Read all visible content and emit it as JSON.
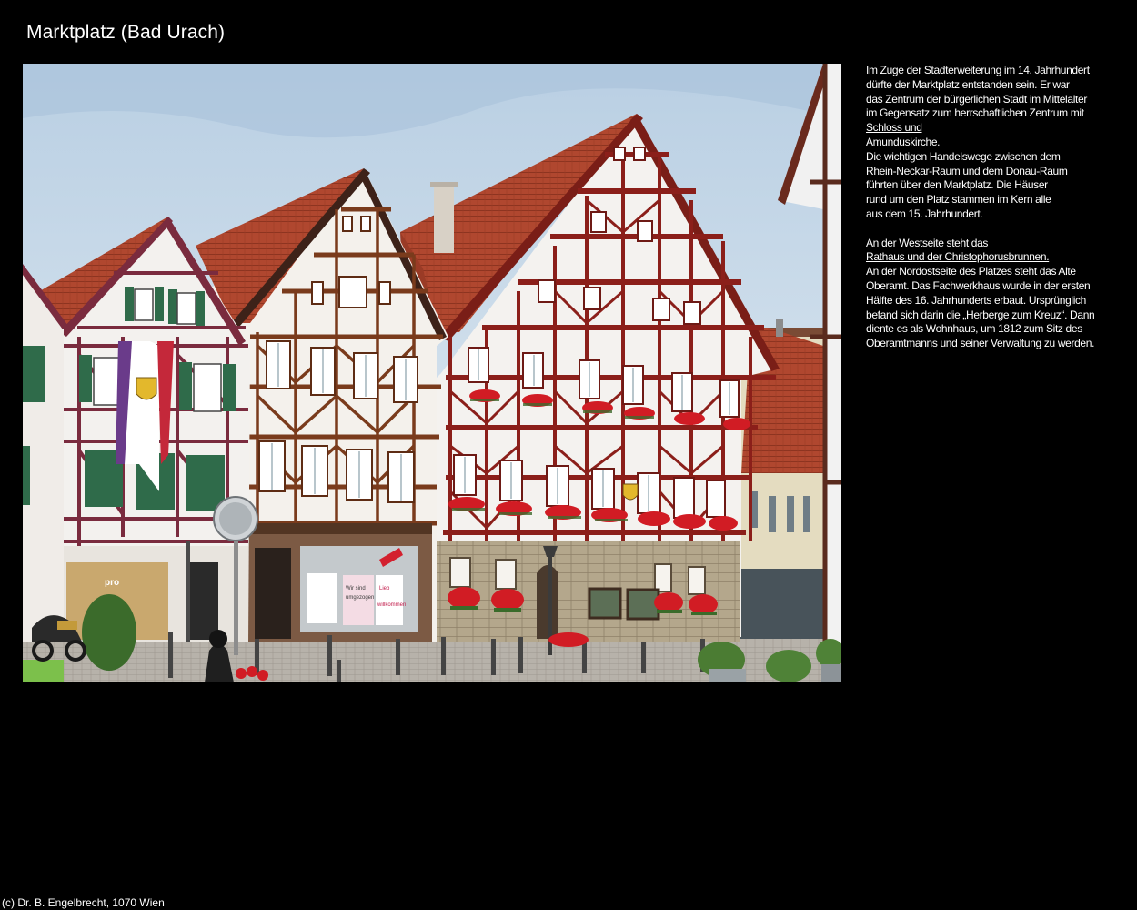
{
  "page": {
    "title": "Marktplatz (Bad Urach)",
    "footer": "(c) Dr. B. Engelbrecht, 1070 Wien"
  },
  "photo": {
    "shop_sign_1": "pro",
    "poster_text_1": "Wir sind",
    "poster_text_2": "umgezogen",
    "poster_text_3": "Lieb",
    "poster_text_4": "willkommen"
  },
  "description": {
    "lines_1": [
      "Im Zuge der Stadterweiterung im 14. Jahrhundert",
      "dürfte der Marktplatz entstanden sein. Er war",
      "das Zentrum der bürgerlichen Stadt im Mittelalter",
      "im Gegensatz zum herrschaftlichen Zentrum mit"
    ],
    "link_1a": "Schloss und",
    "link_1b": "Amunduskirche.",
    "lines_2": [
      "Die wichtigen Handelswege zwischen dem",
      "Rhein-Neckar-Raum und dem Donau-Raum",
      "führten über den Marktplatz. Die Häuser",
      "rund um den Platz stammen im Kern alle",
      "aus dem 15. Jahrhundert."
    ],
    "line_3": "An der Westseite steht das",
    "link_2": "Rathaus und der Christophorusbrunnen.",
    "lines_4": [
      "An der Nordostseite des Platzes steht das Alte",
      "Oberamt. Das Fachwerkhaus wurde in der ersten",
      "Hälfte des 16. Jahrhunderts erbaut. Ursprünglich",
      "befand sich darin die „Herberge zum Kreuz“. Dann",
      "diente es als Wohnhaus, um 1812 zum Sitz des",
      "Oberamtmanns und seiner Verwaltung zu werden."
    ]
  }
}
